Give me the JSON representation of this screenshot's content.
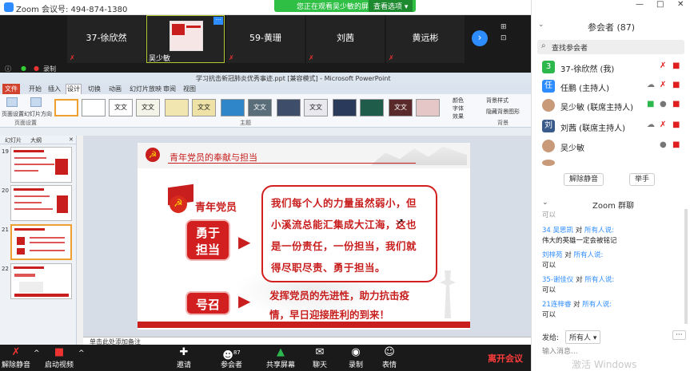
{
  "window": {
    "title": "Zoom 会议号: 494-874-1380",
    "minimize_glyph": "—",
    "maximize_glyph": "□",
    "close_glyph": "✕"
  },
  "share_banner": {
    "text": "您正在观看吴少敏的屏幕",
    "options_label": "查看选项 ▾"
  },
  "video_strip": {
    "tiles": [
      "37-徐欣然",
      "吴少敏",
      "59-黄珊",
      "刘茜",
      "黄远彬"
    ],
    "more_glyph": "···",
    "next_glyph": "›",
    "recording_label": "录制"
  },
  "ppt": {
    "title": "学习抗击新冠肺炎优秀事迹.ppt [兼容模式] - Microsoft PowerPoint",
    "tabs": [
      "文件",
      "开始",
      "插入",
      "设计",
      "切换",
      "动画",
      "幻灯片放映",
      "审阅",
      "视图"
    ],
    "ribbon": {
      "page_setup": "页面设置",
      "orientation": "幻灯片方向",
      "group_page": "页面设置",
      "group_theme": "主题",
      "group_bg": "背景",
      "theme_text": "文文",
      "colors": "颜色",
      "fonts": "字体",
      "effects": "效果",
      "bg_style": "背景样式",
      "hide_bg": "隐藏背景图形"
    },
    "left_tabs": [
      "幻灯片",
      "大纲"
    ],
    "slide_numbers": [
      "19",
      "20",
      "21",
      "22"
    ],
    "notes_placeholder": "单击此处添加备注"
  },
  "slide": {
    "header_title": "青年党员的奉献与担当",
    "youth_label": "青年党员",
    "badge1": [
      "勇于",
      "担当"
    ],
    "text1_lines": [
      "我们每个人的力量虽然弱小，但",
      "小溪流总能汇集成大江海，这也",
      "是一份责任，一份担当，我们就",
      "得尽职尽责、勇于担当。"
    ],
    "badge2": "号召",
    "text2_lines": [
      "发挥党员的先进性，助力抗击疫",
      "情，早日迎接胜利的到来！"
    ],
    "emblem_glyph": "☭",
    "arrow_glyph": "▶"
  },
  "toolbar": {
    "mute": "解除静音",
    "video": "启动视频",
    "invite": "邀请",
    "participants": "参会者",
    "participant_count": "87",
    "share": "共享屏幕",
    "chat": "聊天",
    "record": "录制",
    "reactions": "表情",
    "leave": "离开会议",
    "caret": "^"
  },
  "panel": {
    "title": "参会者 (87)",
    "search_placeholder": "查找参会者",
    "participants": [
      {
        "avatar": "3",
        "name": "37-徐欣然 (我)",
        "color": "#2db84d"
      },
      {
        "avatar": "任",
        "name": "任鹏 (主持人)",
        "color": "#2d8cff"
      },
      {
        "avatar": "",
        "name": "吴少敏 (联席主持人)",
        "color": "#c89a7a"
      },
      {
        "avatar": "刘",
        "name": "刘茜 (联席主持人)",
        "color": "#3a5a8a"
      },
      {
        "avatar": "",
        "name": "吴少敏",
        "color": "#c89a7a"
      }
    ],
    "unmute_all": "解除静音",
    "raise_hand": "举手",
    "chat_title": "Zoom 群聊",
    "partial_top": "可以",
    "messages": [
      {
        "sender": "34 吴思凯",
        "to": "对",
        "target": "所有人说:",
        "body": "伟大的英雄一定会被铭记"
      },
      {
        "sender": "刘梓苑",
        "to": "对",
        "target": "所有人说:",
        "body": "可以"
      },
      {
        "sender": "35-谢佳仪",
        "to": "对",
        "target": "所有人说:",
        "body": "可以"
      },
      {
        "sender": "21连梓睿",
        "to": "对",
        "target": "所有人说:",
        "body": "可以"
      }
    ],
    "send_to_label": "发给:",
    "send_to_value": "所有人 ▾",
    "input_placeholder": "输入消息...",
    "watermark": "激活 Windows"
  }
}
